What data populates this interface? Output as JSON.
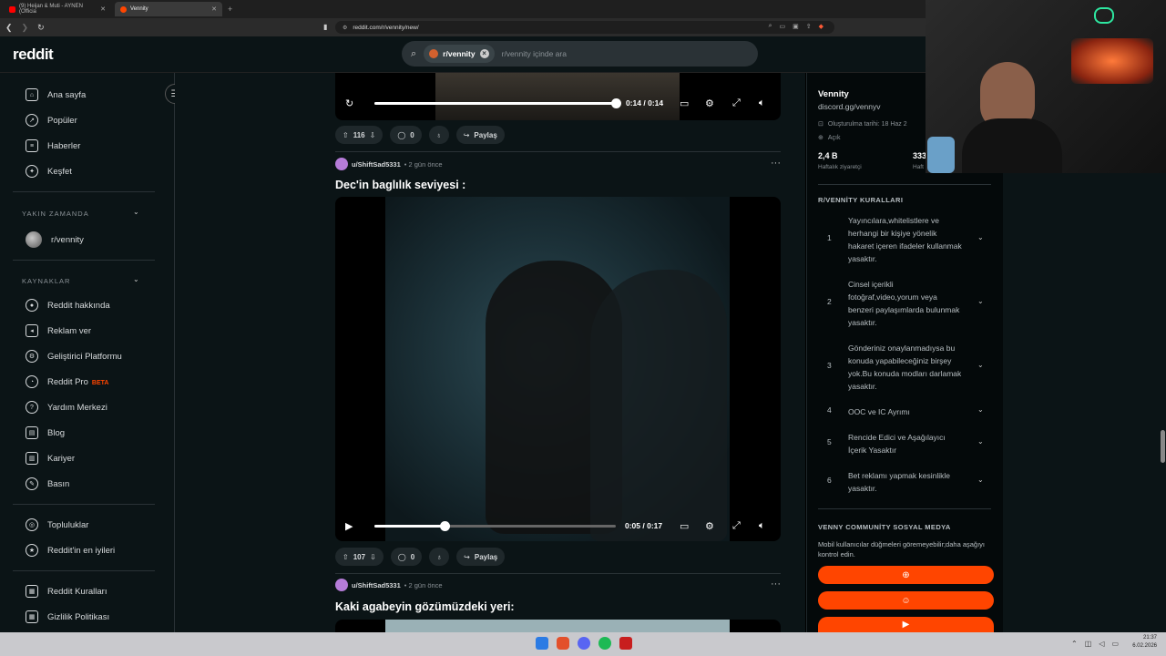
{
  "browser": {
    "tabs": [
      {
        "title": "(9) Heijan & Muti - AYNEN (Officia",
        "close": "✕"
      },
      {
        "title": "Vennity",
        "close": "✕"
      }
    ],
    "new_tab": "+",
    "url": "reddit.com/r/vennity/new/"
  },
  "header": {
    "logo": "reddit",
    "search_chip": "r/vennity",
    "search_placeholder": "r/vennity içinde ara"
  },
  "left_nav": {
    "main": [
      {
        "label": "Ana sayfa",
        "icon": "home-icon"
      },
      {
        "label": "Popüler",
        "icon": "popular-icon"
      },
      {
        "label": "Haberler",
        "icon": "news-icon"
      },
      {
        "label": "Keşfet",
        "icon": "explore-icon"
      }
    ],
    "recent_header": "YAKIN ZAMANDA",
    "recent": [
      {
        "label": "r/vennity"
      }
    ],
    "resources_header": "KAYNAKLAR",
    "resources": [
      {
        "label": "Reddit hakkında",
        "icon": "reddit-icon"
      },
      {
        "label": "Reklam ver",
        "icon": "megaphone-icon"
      },
      {
        "label": "Geliştirici Platformu",
        "icon": "developer-icon"
      },
      {
        "label": "Reddit Pro",
        "icon": "pro-icon",
        "badge": "BETA"
      },
      {
        "label": "Yardım Merkezi",
        "icon": "help-icon"
      },
      {
        "label": "Blog",
        "icon": "blog-icon"
      },
      {
        "label": "Kariyer",
        "icon": "careers-icon"
      },
      {
        "label": "Basın",
        "icon": "press-icon"
      }
    ],
    "communities": [
      {
        "label": "Topluluklar",
        "icon": "communities-icon"
      },
      {
        "label": "Reddit'in en iyileri",
        "icon": "best-of-icon"
      }
    ],
    "policies": [
      {
        "label": "Reddit Kuralları",
        "icon": "rules-icon"
      },
      {
        "label": "Gizlilik Politikası",
        "icon": "privacy-icon"
      }
    ]
  },
  "feed": {
    "post0": {
      "player_time": "0:14 / 0:14",
      "progress": 1.0,
      "votes": "116",
      "comments": "0",
      "share": "Paylaş"
    },
    "post1": {
      "user": "u/ShiftSad5331",
      "time": "• 2 gün önce",
      "title": "Dec'in baglılık seviyesi :",
      "player_time": "0:05 / 0:17",
      "progress": 0.294,
      "votes": "107",
      "comments": "0",
      "share": "Paylaş"
    },
    "post2": {
      "user": "u/ShiftSad5331",
      "time": "• 2 gün önce",
      "title": "Kaki agabeyin gözümüzdeki yeri:"
    }
  },
  "sidebar": {
    "name": "Vennity",
    "discord": "discord.gg/vennyv",
    "created": "Oluşturulma tarihi: 18 Haz 2",
    "status": "Açık",
    "stat1_value": "2,4 B",
    "stat1_label": "Haftalık ziyaretçi",
    "stat2_value": "333",
    "stat2_label": "Haft",
    "rules_header": "R/VENNİTY KURALLARI",
    "rules": [
      {
        "num": "1",
        "text": "Yayıncılara,whitelistlere ve herhangi bir kişiye yönelik hakaret içeren ifadeler kullanmak yasaktır."
      },
      {
        "num": "2",
        "text": "Cinsel içerikli fotoğraf,video,yorum veya benzeri paylaşımlarda bulunmak yasaktır."
      },
      {
        "num": "3",
        "text": "Gönderiniz onaylanmadıysa bu konuda yapabileceğiniz birşey yok.Bu konuda modları darlamak yasaktır."
      },
      {
        "num": "4",
        "text": "OOC ve IC Ayrımı"
      },
      {
        "num": "5",
        "text": "Rencide Edici ve Aşağılayıcı İçerik Yasaktır"
      },
      {
        "num": "6",
        "text": "Bet reklamı yapmak kesinlikle yasaktır."
      }
    ],
    "social_header": "VENNY COMMUNİTY SOSYAL MEDYA",
    "social_desc": "Mobil kullanıcılar düğmeleri göremeyebilir;daha aşağıyı kontrol edin."
  },
  "taskbar": {
    "time": "21:37",
    "date": "6.02.2026"
  },
  "colors": {
    "accent": "#ff4500",
    "background": "#0b1416"
  }
}
